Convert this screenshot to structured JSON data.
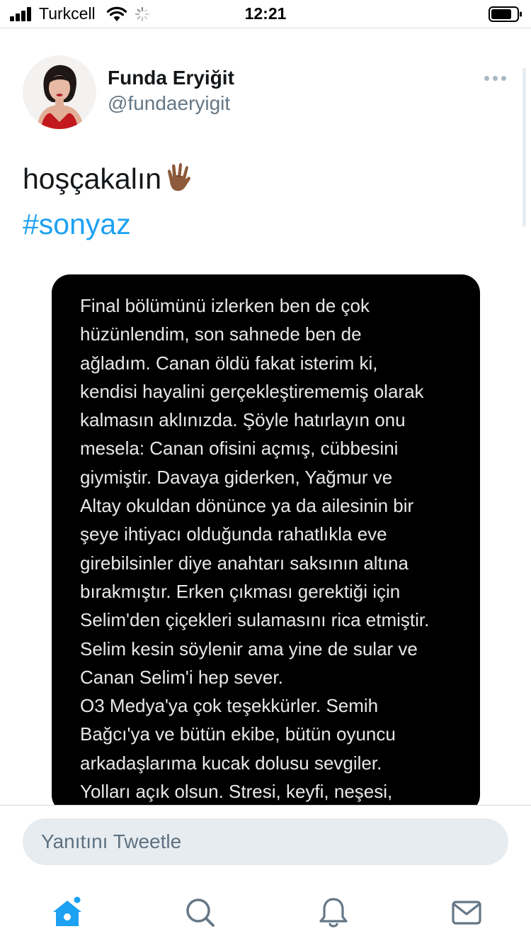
{
  "status_bar": {
    "carrier": "Turkcell",
    "time": "12:21"
  },
  "tweet": {
    "author_name": "Funda Eryiğit",
    "author_handle": "@fundaeryigit",
    "text": "hoşçakalın",
    "emoji_icon": "vulcan-salute-icon",
    "hashtag": "#sonyaz",
    "media_text": "Final bölümünü izlerken ben de çok\nhüzünlendim, son sahnede ben de\nağladım. Canan öldü fakat isterim ki,\nkendisi hayalini gerçekleştirememiş olarak\nkalmasın aklınızda. Şöyle hatırlayın onu\nmesela: Canan ofisini açmış, cübbesini\ngiymiştir. Davaya giderken, Yağmur ve\nAltay okuldan dönünce ya da ailesinin bir\nşeye ihtiyacı olduğunda rahatlıkla eve\ngirebilsinler diye anahtarı saksının altına\nbırakmıştır. Erken çıkması gerektiği için\nSelim'den çiçekleri sulamasını rica etmiştir.\nSelim kesin söylenir ama yine de sular ve\nCanan Selim'i hep sever.\nO3 Medya'ya çok teşekkürler. Semih\nBağcı'ya ve bütün ekibe, bütün oyuncu\narkadaşlarıma kucak dolusu sevgiler.\nYolları açık olsun. Stresi, keyfi, neşesi,"
  },
  "reply": {
    "placeholder": "Yanıtını Tweetle"
  },
  "tabs": [
    {
      "icon": "home-icon",
      "active": true
    },
    {
      "icon": "search-icon",
      "active": false
    },
    {
      "icon": "bell-icon",
      "active": false
    },
    {
      "icon": "mail-icon",
      "active": false
    }
  ],
  "colors": {
    "accent": "#1da1f2",
    "handle": "#657786",
    "input_bg": "#e6ecf0"
  }
}
